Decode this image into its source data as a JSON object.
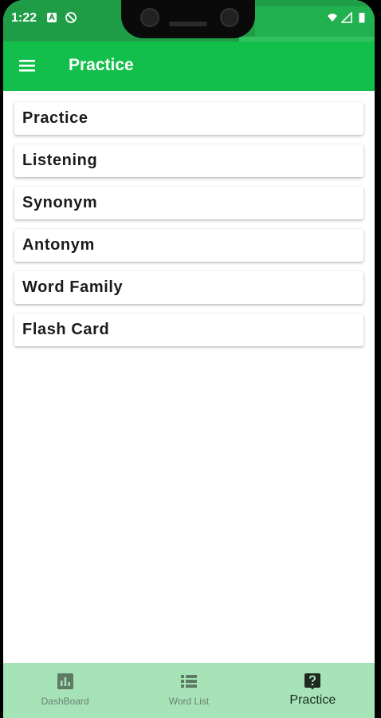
{
  "status_bar": {
    "time": "1:22"
  },
  "app_bar": {
    "title": "Practice"
  },
  "practice_list": [
    {
      "label": "Practice"
    },
    {
      "label": "Listening"
    },
    {
      "label": "Synonym"
    },
    {
      "label": "Antonym"
    },
    {
      "label": "Word Family"
    },
    {
      "label": "Flash Card"
    }
  ],
  "bottom_nav": [
    {
      "label": "DashBoard",
      "icon": "bar-chart-icon",
      "active": false
    },
    {
      "label": "Word List",
      "icon": "list-icon",
      "active": false
    },
    {
      "label": "Practice",
      "icon": "question-icon",
      "active": true
    }
  ],
  "colors": {
    "app_bar": "#12bf4a",
    "status_bar": "#1f9d46",
    "bottom_nav": "#a6e3b6"
  }
}
